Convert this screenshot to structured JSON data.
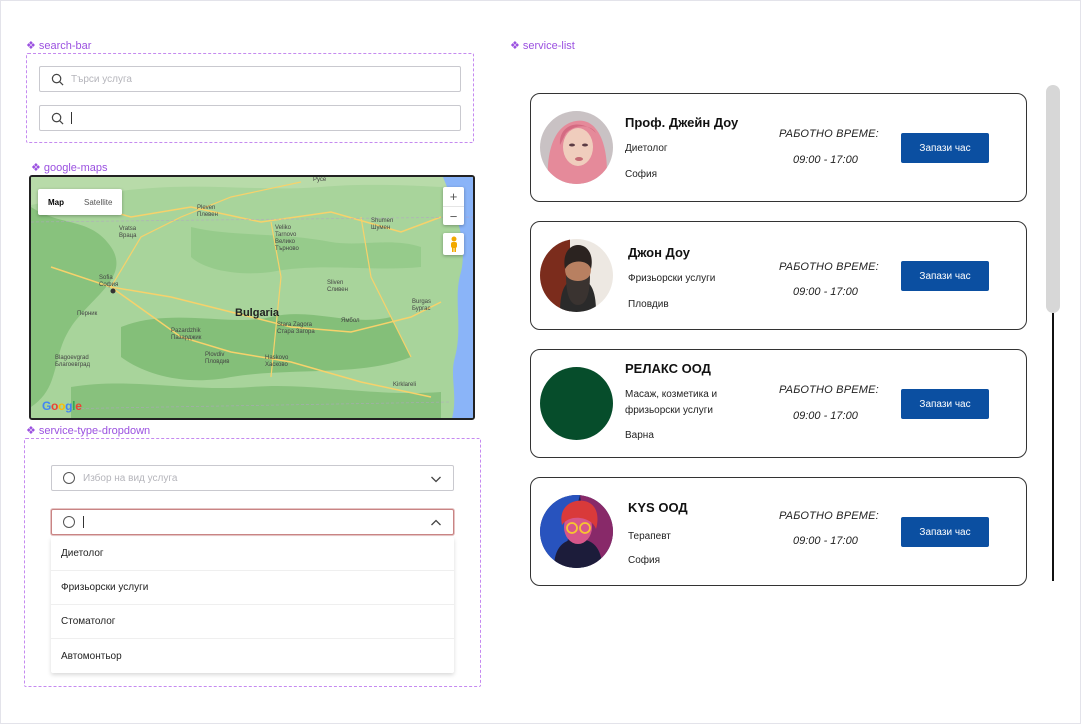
{
  "labels": {
    "search_bar": "search-bar",
    "service_list": "service-list",
    "google_maps": "google-maps",
    "service_type_dropdown": "service-type-dropdown"
  },
  "search": {
    "placeholder": "Търси услуга",
    "active_value": ""
  },
  "map": {
    "type_map": "Map",
    "type_satellite": "Satellite",
    "zoom_in": "+",
    "zoom_out": "−",
    "country": "Bulgaria",
    "logo": "Google",
    "cities": {
      "ruse": "Русе",
      "pleven": "Pleven\nПлевен",
      "vratsa": "Vratsa\nВраца",
      "veliko": "Veliko\nTarnovo\nВелико\nТърново",
      "shumen": "Shumen\nШумен",
      "sofia": "Sofia\nСофия",
      "pernik": "Перник",
      "sliven": "Sliven\nСливен",
      "burgas": "Burgas\nБургас",
      "pazardzhik": "Pazardzhik\nПазарджик",
      "stara_zagora": "Stara Zagora\nСтара Загора",
      "yambol": "Ямбол",
      "plovdiv": "Plovdiv\nПловдив",
      "haskovo": "Haskovo\nХасково",
      "blagoevgrad": "Blagoevgrad\nБлагоевград",
      "kirklareli": "Kirklareli"
    },
    "colors": {
      "land": "#9ecf95",
      "forest": "#7fbf78",
      "sea": "#8ab4f8",
      "road": "#f7d26b"
    }
  },
  "dropdown": {
    "placeholder": "Избор на вид услуга",
    "active_value": "",
    "options": [
      "Диетолог",
      "Фризьорски услуги",
      "Стоматолог",
      "Автомонтьор"
    ]
  },
  "services": [
    {
      "name": "Проф. Джейн Доу",
      "category": "Диетолог",
      "city": "София",
      "hours_label": "РАБОТНО ВРЕМЕ:",
      "hours": "09:00 - 17:00",
      "button": "Запази час",
      "avatar": "woman-pink-hair"
    },
    {
      "name": "Джон Доу",
      "category": "Фризьорски услуги",
      "city": "Пловдив",
      "hours_label": "РАБОТНО ВРЕМЕ:",
      "hours": "09:00 - 17:00",
      "button": "Запази час",
      "avatar": "bearded-man"
    },
    {
      "name": "РЕЛАКС ООД",
      "category": "Масаж, козметика и фризьорски услуги",
      "city": "Варна",
      "hours_label": "РАБОТНО ВРЕМЕ:",
      "hours": "09:00 - 17:00",
      "button": "Запази час",
      "avatar": "green-circle"
    },
    {
      "name": "KYS ООД",
      "category": "Терапевт",
      "city": "София",
      "hours_label": "РАБОТНО ВРЕМЕ:",
      "hours": "09:00 - 17:00",
      "button": "Запази час",
      "avatar": "woman-neon-glasses"
    }
  ],
  "colors": {
    "accent": "#0b4fa1",
    "annotation": "#9b51e0",
    "relax_avatar": "#064d2b"
  }
}
